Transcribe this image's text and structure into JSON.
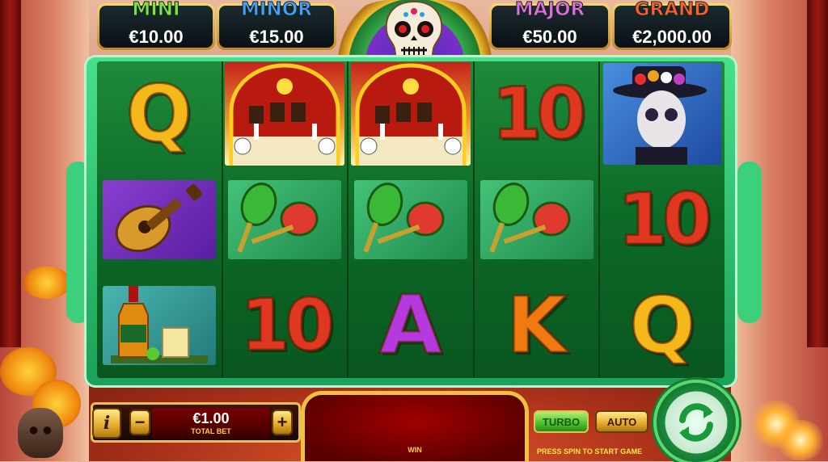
{
  "jackpots": {
    "mini": {
      "label": "MINI",
      "value": "€10.00",
      "color": "#7fe04a"
    },
    "minor": {
      "label": "MINOR",
      "value": "€15.00",
      "color": "#4a9aff"
    },
    "major": {
      "label": "MAJOR",
      "value": "€50.00",
      "color": "#e46ae0"
    },
    "grand": {
      "label": "GRAND",
      "value": "€2,000.00",
      "color": "#ff5a3a"
    }
  },
  "reels": [
    [
      "Q",
      "guitar",
      "tequila"
    ],
    [
      "altar",
      "maracas",
      "10"
    ],
    [
      "altar",
      "maracas",
      "A"
    ],
    [
      "10",
      "maracas",
      "K"
    ],
    [
      "catrin",
      "10",
      "Q"
    ]
  ],
  "symbols": {
    "Q": "Q",
    "10": "10",
    "A": "A",
    "K": "K"
  },
  "controls": {
    "info_label": "i",
    "minus_label": "−",
    "plus_label": "+",
    "bet_value": "€1.00",
    "bet_label": "TOTAL BET",
    "win_label": "WIN",
    "turbo_label": "TURBO",
    "auto_label": "AUTO",
    "hint": "PRESS SPIN TO START GAME"
  },
  "icons": {
    "spin": "spin-arrows-icon",
    "skull": "skull-icon"
  }
}
